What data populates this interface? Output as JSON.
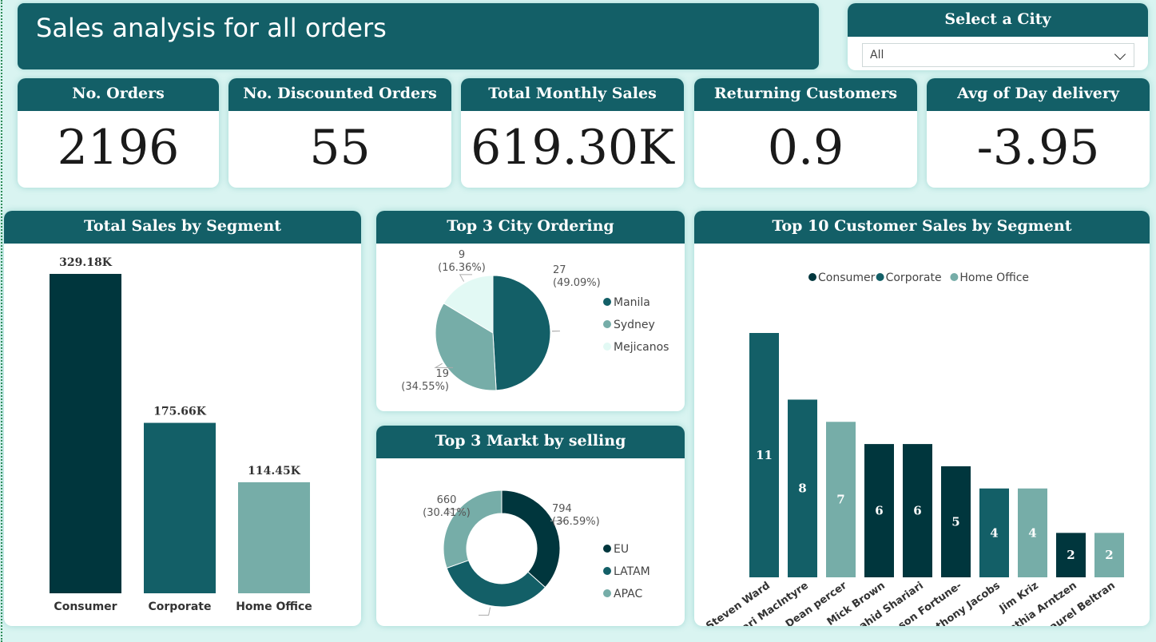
{
  "header": {
    "title": "Sales analysis for all orders"
  },
  "slicer": {
    "title": "Select  a City",
    "value": "All"
  },
  "kpis": [
    {
      "label": "No. Orders",
      "value": "2196"
    },
    {
      "label": "No. Discounted Orders",
      "value": "55"
    },
    {
      "label": "Total Monthly Sales",
      "value": "619.30K"
    },
    {
      "label": "Returning Customers",
      "value": "0.9"
    },
    {
      "label": "Avg of Day delivery",
      "value": "-3.95"
    }
  ],
  "colors": {
    "dark": "#00363d",
    "mid": "#135f67",
    "light": "#76ada8",
    "pale": "#e2f9f4"
  },
  "chart_data": [
    {
      "type": "bar",
      "title": "Total Sales by Segment",
      "categories": [
        "Consumer",
        "Corporate",
        "Home Office"
      ],
      "values": [
        329.18,
        175.66,
        114.45
      ],
      "value_labels": [
        "329.18K",
        "175.66K",
        "114.45K"
      ],
      "ylim": [
        0,
        329.18
      ],
      "grid": false
    },
    {
      "type": "pie",
      "title": "Top 3 City Ordering",
      "legend": [
        "Manila",
        "Sydney",
        "Mejicanos"
      ],
      "legend_position": "right",
      "slices": [
        {
          "name": "Manila",
          "value": 27,
          "pct": "(49.09%)"
        },
        {
          "name": "Sydney",
          "value": 19,
          "pct": "(34.55%)"
        },
        {
          "name": "Mejicanos",
          "value": 9,
          "pct": "(16.36%)"
        }
      ]
    },
    {
      "type": "pie",
      "title": "Top 3 Markt by selling",
      "donut": true,
      "legend": [
        "EU",
        "LATAM",
        "APAC"
      ],
      "legend_position": "right",
      "slices": [
        {
          "name": "EU",
          "value": 794,
          "pct": "(36.59%)"
        },
        {
          "name": "LATAM",
          "value": 716,
          "pct": "(33%)"
        },
        {
          "name": "APAC",
          "value": 660,
          "pct": "(30.41%)"
        }
      ]
    },
    {
      "type": "bar",
      "title": "Top 10 Customer  Sales by Segment",
      "legend": [
        "Consumer",
        "Corporate",
        "Home Office"
      ],
      "legend_position": "top",
      "categories": [
        "Steven Ward",
        "Cari MacIntyre",
        "Dean percer",
        "Mick Brown",
        "Shahid Shariari",
        "Jason Fortune-",
        "Anthony Jacobs",
        "Jim Kriz",
        "Cynthia Arntzen",
        "Laurel Beltran"
      ],
      "values": [
        11,
        8,
        7,
        6,
        6,
        5,
        4,
        4,
        2,
        2
      ],
      "segments": [
        "Corporate",
        "Corporate",
        "Home Office",
        "Consumer",
        "Consumer",
        "Consumer",
        "Corporate",
        "Home Office",
        "Consumer",
        "Home Office"
      ],
      "ylim": [
        0,
        11
      ],
      "grid": false
    }
  ]
}
